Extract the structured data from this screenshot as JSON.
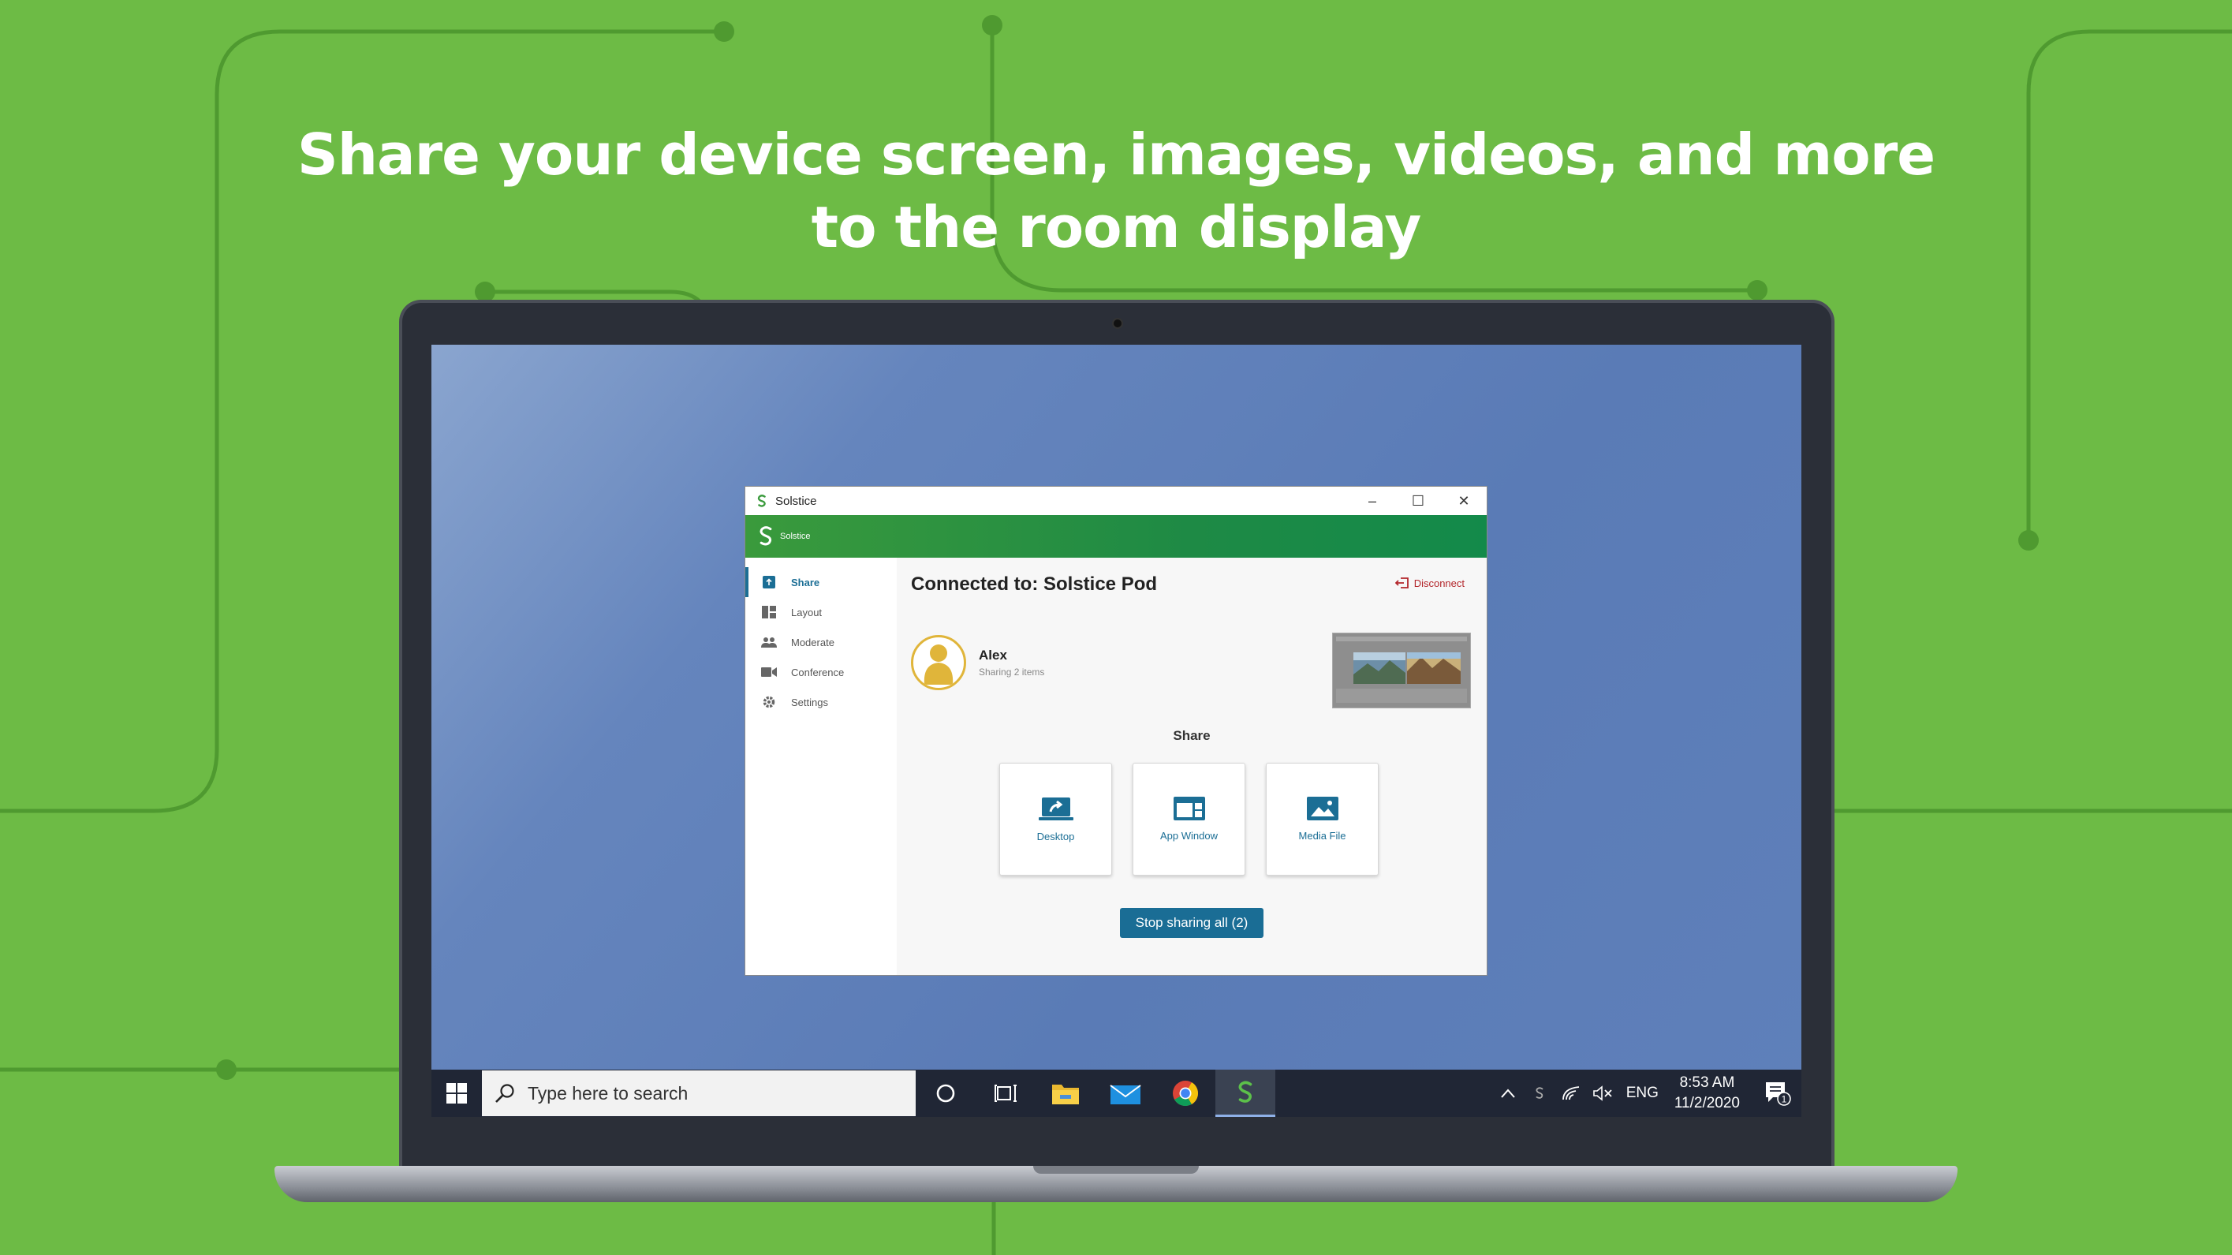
{
  "headline": {
    "line1": "Share your device screen, images, videos, and more",
    "line2": "to the room display"
  },
  "colors": {
    "background": "#6dbb45",
    "brand_green": "#1e8a45",
    "accent_blue": "#1b6e95",
    "disconnect_red": "#b3262b",
    "taskbar": "#202635"
  },
  "window": {
    "title": "Solstice",
    "brand": "Solstice",
    "controls": {
      "minimize": "–",
      "maximize": "☐",
      "close": "✕"
    },
    "nav": [
      {
        "label": "Share",
        "icon": "share-upload-icon",
        "active": true
      },
      {
        "label": "Layout",
        "icon": "layout-grid-icon",
        "active": false
      },
      {
        "label": "Moderate",
        "icon": "people-icon",
        "active": false
      },
      {
        "label": "Conference",
        "icon": "video-camera-icon",
        "active": false
      },
      {
        "label": "Settings",
        "icon": "gear-icon",
        "active": false
      }
    ],
    "connected_title": "Connected to: Solstice Pod",
    "disconnect_label": "Disconnect",
    "user": {
      "name": "Alex",
      "status": "Sharing 2 items"
    },
    "share_heading": "Share",
    "share_options": [
      {
        "label": "Desktop",
        "icon": "desktop-share-icon"
      },
      {
        "label": "App Window",
        "icon": "app-window-icon"
      },
      {
        "label": "Media File",
        "icon": "image-icon"
      }
    ],
    "stop_button": "Stop sharing all (2)"
  },
  "taskbar": {
    "search_placeholder": "Type here to search",
    "pinned": [
      "cortana-icon",
      "task-view-icon",
      "file-explorer-icon",
      "mail-icon",
      "chrome-icon",
      "solstice-icon"
    ],
    "language": "ENG",
    "time": "8:53 AM",
    "date": "11/2/2020",
    "notification_count": "1"
  }
}
